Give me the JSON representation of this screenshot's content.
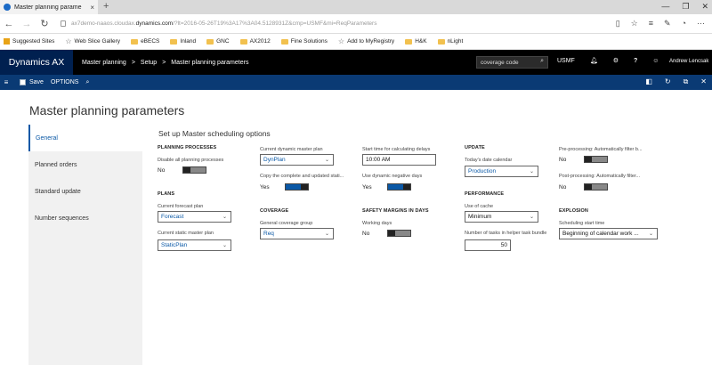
{
  "browser": {
    "tab_title": "Master planning parame",
    "tab_close": "×",
    "new_tab": "+",
    "url_prefix": "ax7demo-naaos.cloudax.",
    "url_domain": "dynamics.com",
    "url_suffix": "/?lt=2016-05-26T19%3A17%3A04.5128931Z&cmp=USMF&mi=ReqParameters",
    "win_min": "—",
    "win_max": "❐",
    "win_close": "✕",
    "favorites": [
      {
        "label": "Suggested Sites",
        "icon": "square-icon"
      },
      {
        "label": "Web Slice Gallery",
        "icon": "star-icon"
      },
      {
        "label": "eBECS",
        "icon": "folder-icon"
      },
      {
        "label": "Inland",
        "icon": "folder-icon"
      },
      {
        "label": "GNC",
        "icon": "folder-icon"
      },
      {
        "label": "AX2012",
        "icon": "folder-icon"
      },
      {
        "label": "Fine Solutions",
        "icon": "folder-icon"
      },
      {
        "label": "Add to MyRegistry",
        "icon": "star-icon"
      },
      {
        "label": "H&K",
        "icon": "folder-icon"
      },
      {
        "label": "nLight",
        "icon": "folder-icon"
      }
    ]
  },
  "app": {
    "brand": "Dynamics AX",
    "breadcrumb": [
      "Master planning",
      ">",
      "Setup",
      ">",
      "Master planning parameters"
    ],
    "search_value": "coverage code",
    "company": "USMF",
    "user": "Andrew Lencsak",
    "actions": {
      "save": "Save",
      "options": "OPTIONS"
    }
  },
  "page": {
    "title": "Master planning parameters",
    "nav": [
      "General",
      "Planned orders",
      "Standard update",
      "Number sequences"
    ],
    "section_title": "Set up Master scheduling options",
    "planning_processes": {
      "header": "PLANNING PROCESSES",
      "disable_label": "Disable all planning processes",
      "disable_value": "No"
    },
    "plans": {
      "header": "PLANS",
      "forecast_label": "Current forecast plan",
      "forecast_value": "Forecast",
      "static_label": "Current static master plan",
      "static_value": "StaticPlan"
    },
    "dynamic": {
      "label": "Current dynamic master plan",
      "value": "DynPlan",
      "copy_label": "Copy the complete and updated stati...",
      "copy_value": "Yes"
    },
    "coverage": {
      "header": "COVERAGE",
      "group_label": "General coverage group",
      "group_value": "Req"
    },
    "delays": {
      "start_label": "Start time for calculating delays",
      "start_value": "10:00 AM",
      "negative_label": "Use dynamic negative days",
      "negative_value": "Yes"
    },
    "safety": {
      "header": "SAFETY MARGINS IN DAYS",
      "working_label": "Working days",
      "working_value": "No"
    },
    "update": {
      "header": "UPDATE",
      "calendar_label": "Today's date calendar",
      "calendar_value": "Production"
    },
    "performance": {
      "header": "PERFORMANCE",
      "cache_label": "Use of cache",
      "cache_value": "Minimum",
      "tasks_label": "Number of tasks in helper task bundle",
      "tasks_value": "50"
    },
    "processing": {
      "pre_label": "Pre-processing: Automatically filter b...",
      "pre_value": "No",
      "post_label": "Post-processing: Automatically filter...",
      "post_value": "No"
    },
    "explosion": {
      "header": "EXPLOSION",
      "start_label": "Scheduling start time",
      "start_value": "Beginning of calendar work ..."
    }
  }
}
